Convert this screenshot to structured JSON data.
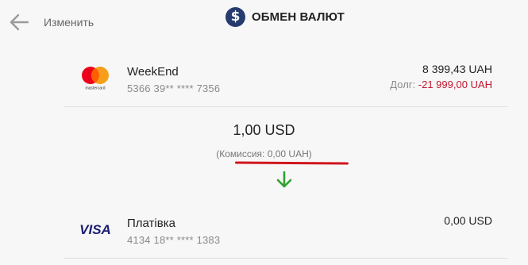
{
  "header": {
    "back_icon": "arrow-left-icon",
    "edit_label": "Изменить",
    "title_icon": "dollar-circle-icon",
    "title_icon_glyph": "$",
    "title": "ОБМЕН ВАЛЮТ"
  },
  "from_card": {
    "brand_icon": "mastercard-logo",
    "brand_logo_text": "mastercard",
    "name": "WeekEnd",
    "number": "5366 39** **** 7356",
    "balance": "8 399,43 UAH",
    "debt_label": "Долг:",
    "debt_value": "-21 999,00 UAH"
  },
  "exchange": {
    "amount": "1,00 USD",
    "commission": "(Комиссия: 0,00 UAH)",
    "direction_icon": "arrow-down-icon"
  },
  "to_card": {
    "brand_icon": "visa-logo",
    "brand_logo_text": "VISA",
    "name": "Платівка",
    "number": "4134 18** **** 1383",
    "balance": "0,00 USD"
  },
  "colors": {
    "accent_navy": "#263b6e",
    "debt_red": "#c0172f",
    "highlight_red": "#d0161f",
    "arrow_green": "#2ea12e"
  }
}
